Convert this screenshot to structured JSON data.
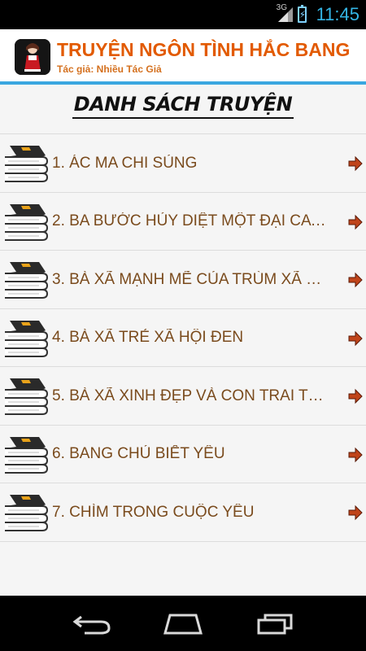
{
  "status_bar": {
    "network": "3G",
    "time": "11:45"
  },
  "header": {
    "title": "TRUYỆN NGÔN TÌNH HẮC BANG",
    "author": "Tác giả: Nhiều Tác Giả"
  },
  "section_title": "DANH SÁCH TRUYỆN",
  "stories": [
    {
      "label": "1. ÁC MA CHI SỦNG"
    },
    {
      "label": "2. BA BƯỚC HỦY DIỆT MỘT ĐẠI CA X..."
    },
    {
      "label": "3. BÀ XÃ MẠNH MẼ CỦA TRÙM XÃ H..."
    },
    {
      "label": "4. BÀ XÃ TRẺ XÃ HỘI ĐEN"
    },
    {
      "label": "5. BÀ XÃ XINH ĐẸP VÀ CON TRAI THI..."
    },
    {
      "label": "6. BANG CHỦ BIẾT YÊU"
    },
    {
      "label": "7. CHÌM TRONG CUỘC YÊU"
    }
  ],
  "colors": {
    "title": "#e25a00",
    "author": "#d4701e",
    "accent_line": "#3aa7e0",
    "item_text": "#7a4b1d",
    "arrow": "#c0441a",
    "clock": "#34b5e5"
  },
  "icons": {
    "row_icon": "book-stack-icon",
    "row_arrow": "arrow-right-icon",
    "nav_back": "back-icon",
    "nav_home": "home-icon",
    "nav_recent": "recent-apps-icon"
  }
}
